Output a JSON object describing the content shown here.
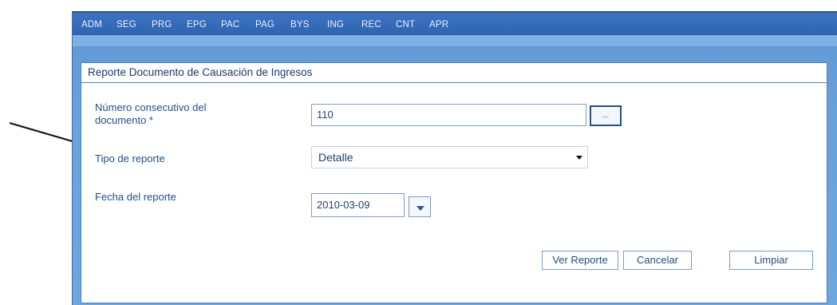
{
  "menu": {
    "items": [
      "ADM",
      "SEG",
      "PRG",
      "EPG",
      "PAC",
      "PAG",
      "BYS",
      "ING",
      "REC",
      "CNT",
      "APR"
    ]
  },
  "panel": {
    "title": "Reporte Documento de Causación de Ingresos"
  },
  "form": {
    "doc_label_line1": "Número consecutivo del",
    "doc_label_line2": "documento *",
    "doc_value": "110",
    "doc_lookup_label": "...",
    "tipo_label": "Tipo de reporte",
    "tipo_value": "Detalle",
    "fecha_label": "Fecha del reporte",
    "fecha_value": "2010-03-09"
  },
  "actions": {
    "ver": "Ver Reporte",
    "cancelar": "Cancelar",
    "limpiar": "Limpiar"
  },
  "colors": {
    "menu_bg": "#2e62b0",
    "panel_border": "#4d7fbf",
    "label_text": "#1f4f88"
  }
}
